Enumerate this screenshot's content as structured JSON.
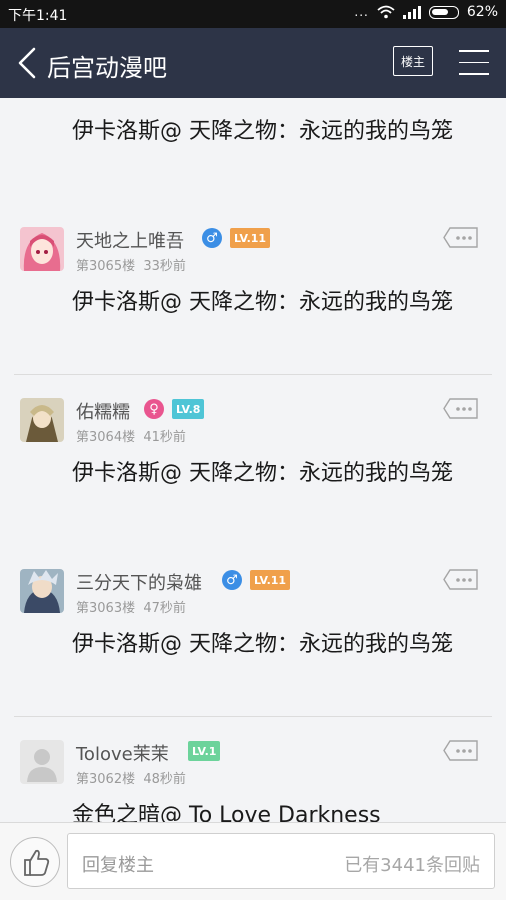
{
  "status": {
    "time": "下午1:41",
    "dots": "...",
    "battery_pct": "62%"
  },
  "nav": {
    "title": "后宫动漫吧",
    "louzhu_label": "楼主"
  },
  "top_post_text": "伊卡洛斯@ 天降之物：永远的我的鸟笼",
  "posts": [
    {
      "username": "天地之上唯吾",
      "gender": "♂",
      "level": "LV.11",
      "floor": "第3065楼",
      "time": "33秒前",
      "text": "伊卡洛斯@ 天降之物：永远的我的鸟笼"
    },
    {
      "username": "佑糯糯",
      "gender": "♀",
      "level": "LV.8",
      "floor": "第3064楼",
      "time": "41秒前",
      "text": "伊卡洛斯@ 天降之物：永远的我的鸟笼"
    },
    {
      "username": "三分天下的枭雄",
      "gender": "♂",
      "level": "LV.11",
      "floor": "第3063楼",
      "time": "47秒前",
      "text": "伊卡洛斯@ 天降之物：永远的我的鸟笼"
    },
    {
      "username": "Tolove茉茉",
      "level": "LV.1",
      "floor": "第3062楼",
      "time": "48秒前",
      "text": "金色之暗@ To Love Darkness"
    }
  ],
  "bottom": {
    "reply_placeholder": "回复楼主",
    "reply_count": "已有3441条回贴"
  },
  "colors": {
    "navbar": "#2d3447",
    "level_orange": "#f0a04b",
    "level_teal": "#4fc5d6",
    "level_green": "#6cd39b",
    "male": "#3b8ee5",
    "female": "#e9558f"
  }
}
